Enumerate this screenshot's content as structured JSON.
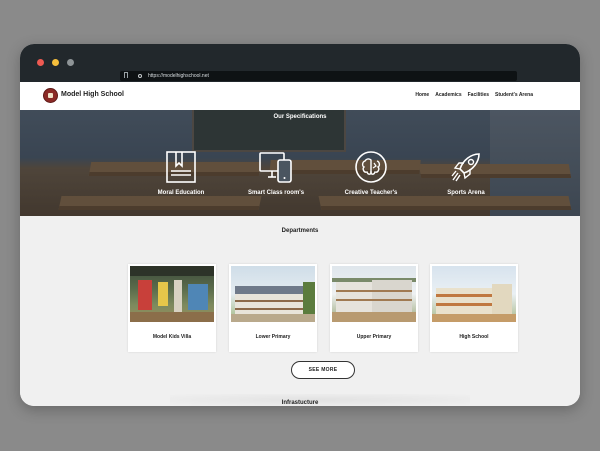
{
  "browser": {
    "url": "https://modelhighschool.net"
  },
  "navbar": {
    "brand": "Model High School",
    "links": [
      "Home",
      "Academics",
      "Facilities",
      "Student's Arena"
    ]
  },
  "specifications": {
    "title": "Our Specifications",
    "items": [
      {
        "label": "Moral Education",
        "icon": "book-icon"
      },
      {
        "label": "Smart Class room's",
        "icon": "devices-icon"
      },
      {
        "label": "Creative Teacher's",
        "icon": "brain-icon"
      },
      {
        "label": "Sports Arena",
        "icon": "rocket-icon"
      }
    ]
  },
  "departments": {
    "title": "Departments",
    "cards": [
      {
        "label": "Model Kids Villa"
      },
      {
        "label": "Lower Primary"
      },
      {
        "label": "Upper Primary"
      },
      {
        "label": "High School"
      }
    ],
    "see_more": "SEE MORE"
  },
  "infrastructure": {
    "title": "Infrastucture"
  },
  "colors": {
    "brand": "#8b2a26",
    "titlebar": "#22282c",
    "content_bg": "#f0f0f0"
  }
}
